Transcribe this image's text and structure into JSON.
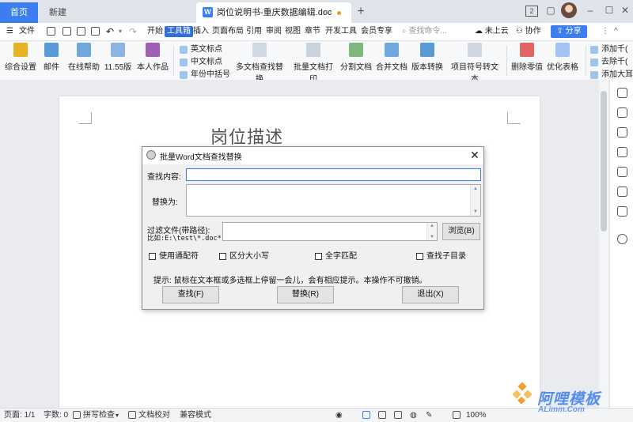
{
  "tabs": {
    "home": "首页",
    "new": "新建",
    "doc": "岗位说明书-重庆数据编辑.doc",
    "doc_icon": "W"
  },
  "window": {
    "layout_badge": "2"
  },
  "menu": {
    "file": "文件",
    "items": [
      "开始",
      "工具箱",
      "插入",
      "页面布局",
      "引用",
      "审阅",
      "视图",
      "章节",
      "开发工具",
      "会员专享"
    ],
    "search_placeholder": "查找命令...",
    "cloud": "未上云",
    "collab": "协作",
    "share": "分享"
  },
  "ribbon": {
    "buttons": [
      "综合设置",
      "邮件",
      "在线帮助",
      "11.55版",
      "本人作品"
    ],
    "small": [
      "英文标点",
      "中文标点",
      "年份中括号"
    ],
    "tools": [
      "多文档查找替换",
      "批量文档打印",
      "分割文档",
      "合并文档",
      "版本转换",
      "项目符号转文本",
      "删除零值",
      "优化表格"
    ],
    "right_small": [
      "添加千(",
      "去除千(",
      "添加大耳"
    ]
  },
  "document": {
    "title": "岗位描述"
  },
  "dialog": {
    "title": "批量Word文档查找替换",
    "find_label": "查找内容:",
    "find_value": "",
    "replace_label": "替换为:",
    "replace_value": "",
    "filter_label": "过滤文件(带路径):",
    "filter_example": "比如:E:\\test\\*.doc*",
    "filter_value": "",
    "browse": "浏览(B)",
    "options": [
      {
        "label": "使用通配符",
        "checked": false
      },
      {
        "label": "区分大小写",
        "checked": false
      },
      {
        "label": "全字匹配",
        "checked": false
      },
      {
        "label": "查找子目录",
        "checked": false
      }
    ],
    "tip": "提示: 鼠标在文本框或多选框上停留一会儿，会有相应提示。本操作不可撤销。",
    "find_btn": "查找(F)",
    "replace_btn": "替换(R)",
    "exit_btn": "退出(X)"
  },
  "status": {
    "page": "页面: 1/1",
    "words": "字数: 0",
    "spell": "拼写检查",
    "proof": "文档校对",
    "compat": "兼容模式",
    "zoom": "100%"
  },
  "watermark": {
    "brand": "阿哩模板",
    "url": "ALimm.Com"
  },
  "colors": {
    "accent": "#3a7ef0",
    "tab_active": "#2f6fd6"
  }
}
